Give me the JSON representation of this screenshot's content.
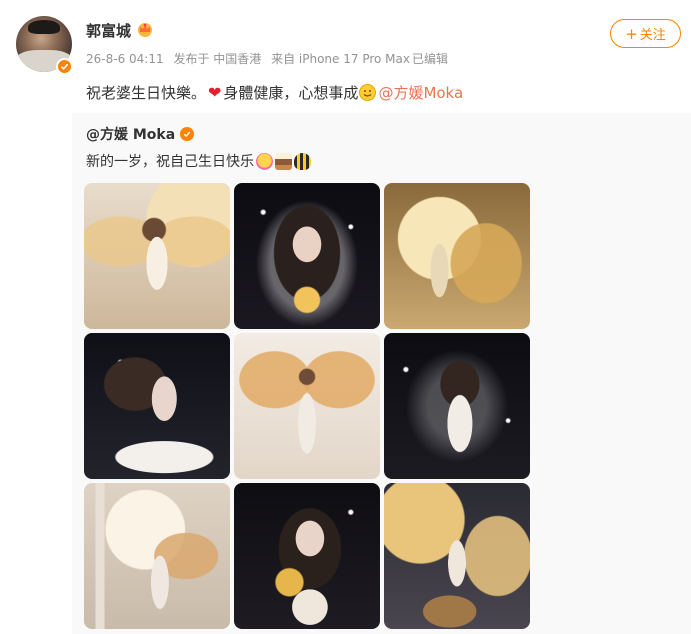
{
  "author": {
    "name": "郭富城",
    "crown_icon": "crown-icon",
    "verified_icon": "verified-badge-icon",
    "avatar_icon": "avatar"
  },
  "meta": {
    "time": "26-8-6 04:11",
    "location": "发布于 中国香港",
    "source": "来自 iPhone 17 Pro Max",
    "edited": "已编辑"
  },
  "follow_button": {
    "plus": "+",
    "label": "关注"
  },
  "post": {
    "text_part1": "祝老婆生日快樂。",
    "heart": "❤",
    "text_part2": "身體健康，心想事成",
    "mention": "@方媛Moka"
  },
  "repost": {
    "author": "@方媛 Moka",
    "text": "新的一岁，祝自己生日快乐",
    "emojis": [
      "party-face-icon",
      "cake-icon",
      "bee-icon"
    ]
  },
  "images": [
    {
      "name": "photo-angel-crescent-moon"
    },
    {
      "name": "photo-starry-gold-rose"
    },
    {
      "name": "photo-golden-wings-moon"
    },
    {
      "name": "photo-dark-flowing-hair"
    },
    {
      "name": "photo-white-wings-light"
    },
    {
      "name": "photo-sparkle-night"
    },
    {
      "name": "photo-full-moon-pillars"
    },
    {
      "name": "photo-dark-gold-bouquet"
    },
    {
      "name": "photo-moon-lion-wings"
    }
  ],
  "colors": {
    "accent": "#ff8200",
    "mention": "#eb7350",
    "meta": "#939393",
    "repost_bg": "#f9f9f9"
  }
}
